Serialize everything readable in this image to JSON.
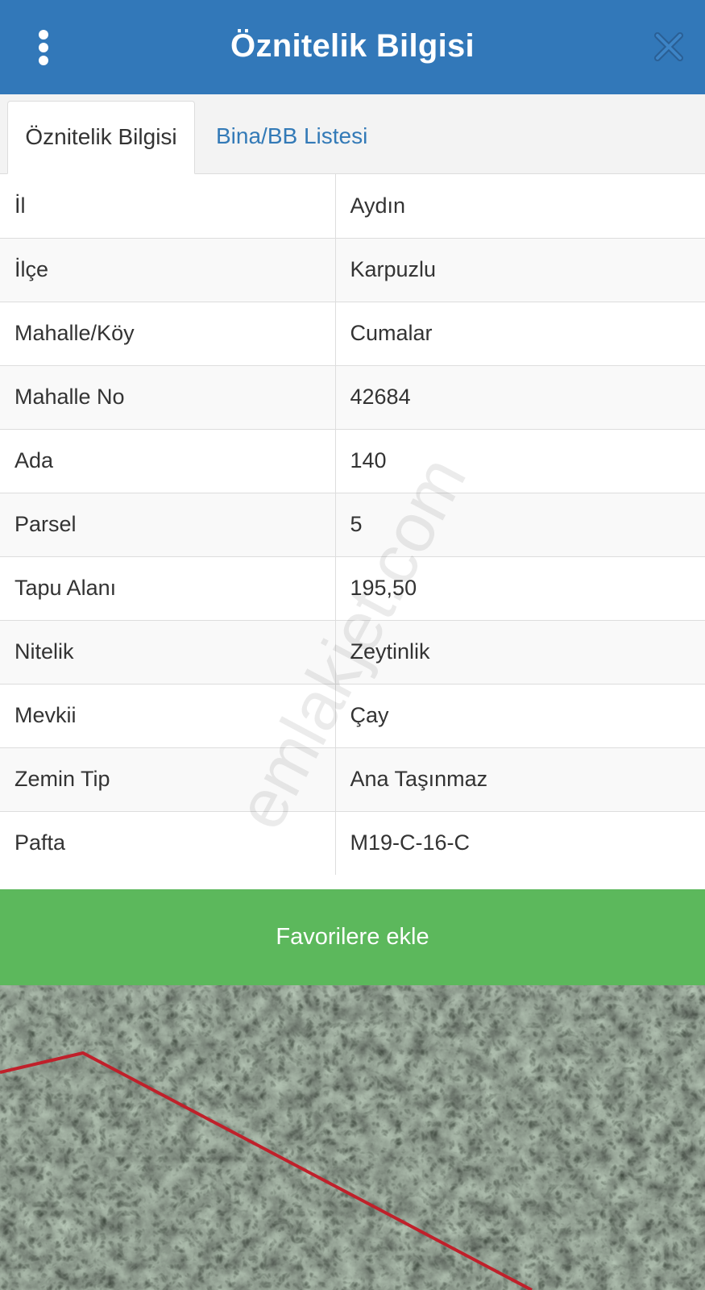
{
  "header": {
    "title": "Öznitelik Bilgisi"
  },
  "tabs": [
    {
      "label": "Öznitelik Bilgisi",
      "active": true
    },
    {
      "label": "Bina/BB Listesi",
      "active": false
    }
  ],
  "attributes": [
    {
      "key": "İl",
      "value": "Aydın"
    },
    {
      "key": "İlçe",
      "value": "Karpuzlu"
    },
    {
      "key": "Mahalle/Köy",
      "value": "Cumalar"
    },
    {
      "key": "Mahalle No",
      "value": "42684"
    },
    {
      "key": "Ada",
      "value": "140"
    },
    {
      "key": "Parsel",
      "value": "5"
    },
    {
      "key": "Tapu Alanı",
      "value": "195,50"
    },
    {
      "key": "Nitelik",
      "value": "Zeytinlik"
    },
    {
      "key": "Mevkii",
      "value": "Çay"
    },
    {
      "key": "Zemin Tip",
      "value": "Ana Taşınmaz"
    },
    {
      "key": "Pafta",
      "value": "M19-C-16-C"
    }
  ],
  "favorite_button": {
    "label": "Favorilere ekle"
  },
  "watermark": "emlakjet.com",
  "colors": {
    "header": "#3278b9",
    "tab_link": "#337ab7",
    "favorite_button": "#5cb85c",
    "parcel_boundary": "#c0202a"
  },
  "icons": {
    "menu": "kebab-menu-icon",
    "close": "close-icon"
  }
}
